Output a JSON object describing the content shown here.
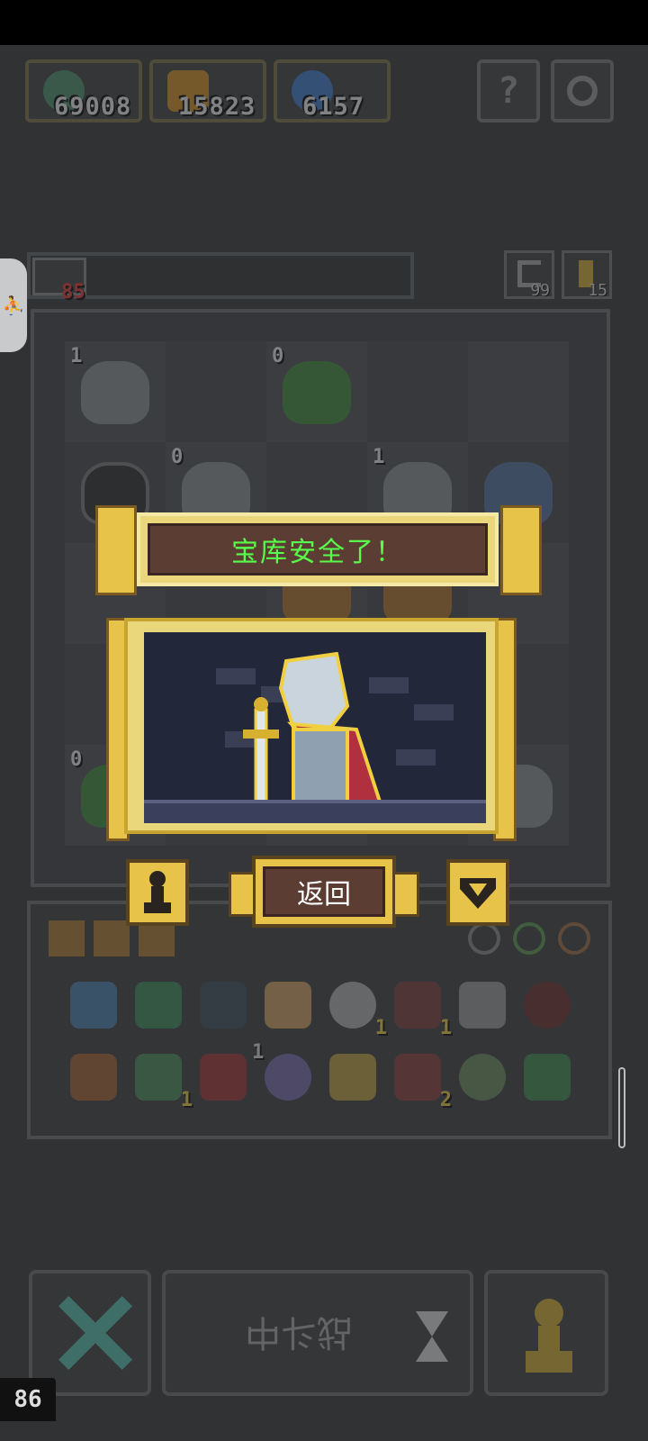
{
  "resources": [
    {
      "name": "gold-coin",
      "value": "69008",
      "color": "#d4a838"
    },
    {
      "name": "trophies",
      "value": "15823",
      "color": "#d89020"
    },
    {
      "name": "gem",
      "value": "6157",
      "color": "#3a7ad0"
    }
  ],
  "header": {
    "help_label": "?"
  },
  "level": {
    "number": "85"
  },
  "side_buttons": [
    {
      "name": "undo-counter",
      "count": "99"
    },
    {
      "name": "key-counter",
      "count": "15"
    }
  ],
  "board_counts": {
    "c1": "1",
    "c2": "0",
    "c3": "0",
    "c4": "1",
    "c5": "0"
  },
  "inventory_counts": {
    "i1": "1",
    "i2": "1",
    "i3": "1",
    "i4": "1",
    "i5": "2",
    "i6": "1"
  },
  "overlay": {
    "title": "宝库安全了！",
    "back_label": "返回"
  },
  "footer": {
    "battle_label": "战斗中",
    "fps": "86"
  }
}
